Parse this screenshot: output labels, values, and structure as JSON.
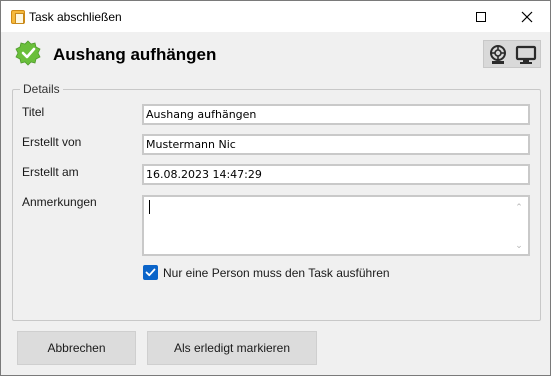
{
  "window": {
    "title": "Task abschließen",
    "app_icon": "task-clipboard-icon",
    "minimize_icon": "minimize-icon",
    "close_icon": "close-icon"
  },
  "header": {
    "title": "Aushang aufhängen",
    "status_icon": "green-check-badge-icon",
    "icons": [
      "help-lifebuoy-icon",
      "monitor-icon"
    ]
  },
  "details": {
    "legend": "Details",
    "fields": {
      "titel": {
        "label": "Titel",
        "value": "Aushang aufhängen"
      },
      "erstellt_von": {
        "label": "Erstellt von",
        "value": "Mustermann Nic"
      },
      "erstellt_am": {
        "label": "Erstellt am",
        "value": "16.08.2023 14:47:29"
      },
      "anmerkungen": {
        "label": "Anmerkungen",
        "value": ""
      }
    },
    "checkbox": {
      "label": "Nur eine Person muss den Task ausführen",
      "checked": true
    }
  },
  "buttons": {
    "cancel": "Abbrechen",
    "done": "Als erledigt markieren"
  },
  "colors": {
    "accent": "#0a64c9",
    "status_green": "#6abf3b"
  }
}
